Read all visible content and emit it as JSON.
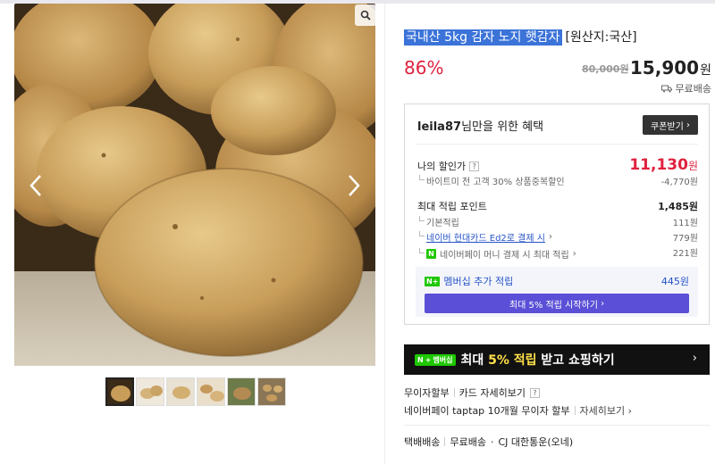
{
  "product": {
    "title_highlight": "국내산 5kg 감자 노지 햇감자",
    "origin": "[원산지:국산]",
    "discount": "86%",
    "original_price": "80,000원",
    "price": "15,900",
    "price_unit": "원",
    "shipping": "무료배송"
  },
  "gallery": {
    "thumbnail_count": 6,
    "active_index": 0
  },
  "benefits": {
    "user": "leila87",
    "header_rest": "님만을 위한 혜택",
    "coupon_button": "쿠폰받기",
    "my_price_label": "나의 할인가",
    "my_price": "11,130",
    "my_price_unit": "원",
    "discount_detail_label": "바이트미 전 고객 30% 상품중복할인",
    "discount_detail_value": "-4,770원",
    "points_label": "최대 적립 포인트",
    "points_value": "1,485원",
    "basic_points_label": "기본적립",
    "basic_points_value": "111원",
    "card_label": "네이버 현대카드 Ed2로 결제 시",
    "card_value": "779원",
    "npay_label": "네이버페이 머니 결제 시 최대 적립",
    "npay_value": "221원",
    "member_label": "멤버십 추가 적립",
    "member_value": "445원",
    "member_button": "최대 5% 적립 시작하기"
  },
  "banner": {
    "badge": "멤버십",
    "text_prefix": "최대 ",
    "text_highlight": "5% 적립",
    "text_suffix": " 받고 쇼핑하기"
  },
  "info": {
    "installment_label": "무이자할부",
    "card_detail_label": "카드 자세히보기",
    "taptap_label": "네이버페이 taptap 10개월 무이자 할부",
    "taptap_detail": "자세히보기",
    "delivery_type": "택배배송",
    "delivery_fee": "무료배송",
    "courier": "CJ 대한통운(오네)"
  },
  "colors": {
    "accent_red": "#e0223f",
    "link_blue": "#2552c7",
    "naver_green": "#1ec800",
    "member_purple": "#5a4fd6"
  }
}
